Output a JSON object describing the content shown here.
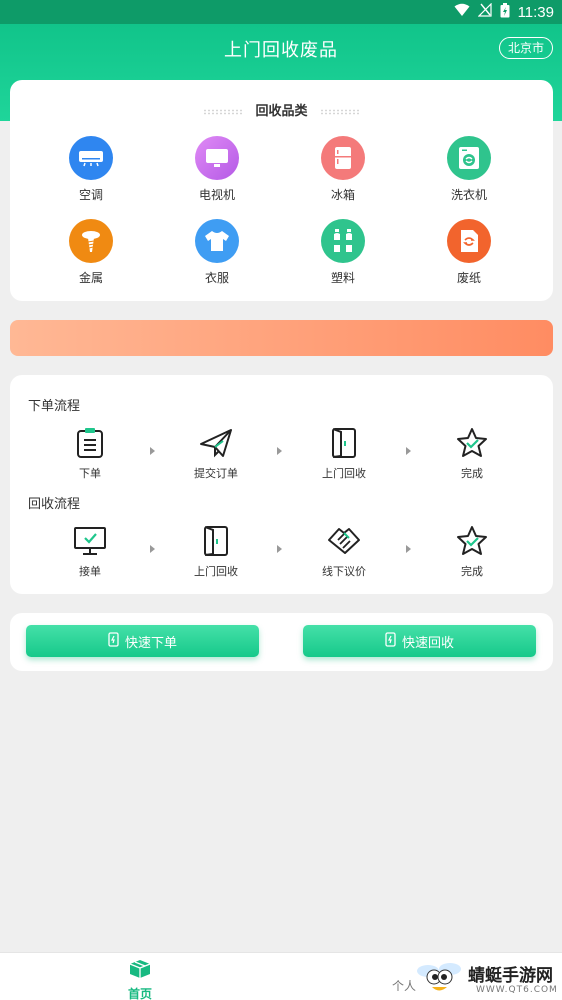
{
  "status_bar": {
    "time": "11:39"
  },
  "header": {
    "title": "上门回收废品",
    "city": "北京市"
  },
  "categories": {
    "title": "回收品类",
    "items": [
      {
        "label": "空调",
        "icon": "air-conditioner-icon",
        "color": "#2f86f0"
      },
      {
        "label": "电视机",
        "icon": "television-icon",
        "color": "#c46ae8"
      },
      {
        "label": "冰箱",
        "icon": "refrigerator-icon",
        "color": "#f26d6d"
      },
      {
        "label": "洗衣机",
        "icon": "washing-machine-icon",
        "color": "#2fc48d"
      },
      {
        "label": "金属",
        "icon": "metal-icon",
        "color": "#f08a12"
      },
      {
        "label": "衣服",
        "icon": "clothes-icon",
        "color": "#3f9df3"
      },
      {
        "label": "塑料",
        "icon": "plastic-bottles-icon",
        "color": "#2fc48d"
      },
      {
        "label": "废纸",
        "icon": "waste-paper-icon",
        "color": "#f2642d"
      }
    ]
  },
  "order_process": {
    "title": "下单流程",
    "steps": [
      {
        "label": "下单",
        "icon": "clipboard-icon"
      },
      {
        "label": "提交订单",
        "icon": "paper-plane-icon"
      },
      {
        "label": "上门回收",
        "icon": "door-icon"
      },
      {
        "label": "完成",
        "icon": "star-check-icon"
      }
    ]
  },
  "recycle_process": {
    "title": "回收流程",
    "steps": [
      {
        "label": "接单",
        "icon": "monitor-check-icon"
      },
      {
        "label": "上门回收",
        "icon": "door-icon"
      },
      {
        "label": "线下议价",
        "icon": "handshake-icon"
      },
      {
        "label": "完成",
        "icon": "star-check-icon"
      }
    ]
  },
  "quick_actions": {
    "order_label": "快速下单",
    "recycle_label": "快速回收"
  },
  "bottom_nav": {
    "home_label": "首页",
    "profile_label": "个人"
  },
  "watermark": {
    "text": "蜻蜓手游网",
    "url": "WWW.QT6.COM"
  },
  "colors": {
    "brand": "#1fd59a",
    "accent_green": "#17b981",
    "banner_start": "#ffb895",
    "banner_end": "#ff8c62"
  }
}
